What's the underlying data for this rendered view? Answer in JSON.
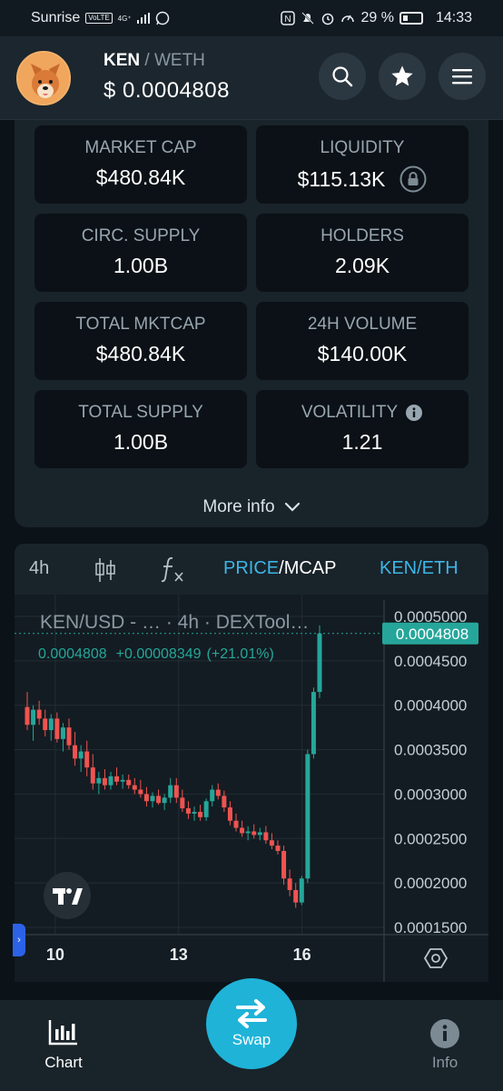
{
  "statusbar": {
    "carrier": "Sunrise",
    "volte": "VoLTE",
    "network": "4G⁺",
    "battery": "29 %",
    "time": "14:33"
  },
  "header": {
    "base_symbol": "KEN",
    "separator": "/",
    "quote_symbol": "WETH",
    "price": "$ 0.0004808"
  },
  "stats": [
    {
      "label": "MARKET CAP",
      "value": "$480.84K"
    },
    {
      "label": "LIQUIDITY",
      "value": "$115.13K",
      "locked": true
    },
    {
      "label": "CIRC. SUPPLY",
      "value": "1.00B"
    },
    {
      "label": "HOLDERS",
      "value": "2.09K"
    },
    {
      "label": "TOTAL MKTCAP",
      "value": "$480.84K"
    },
    {
      "label": "24H VOLUME",
      "value": "$140.00K"
    },
    {
      "label": "TOTAL SUPPLY",
      "value": "1.00B"
    },
    {
      "label": "VOLATILITY",
      "value": "1.21",
      "info": true
    }
  ],
  "more_info": "More info",
  "toolbar": {
    "interval": "4h",
    "price": "PRICE",
    "slash": "/",
    "mcap": "MCAP",
    "pair_toggle": "KEN/ETH"
  },
  "chart_data": {
    "type": "candlestick",
    "title": "KEN/USD - … · 4h · DEXTool…",
    "legend": {
      "last": "0.0004808",
      "change": "+0.00008349",
      "change_pct": "(+21.01%)"
    },
    "current_price_tag": "0.0004808",
    "y_ticks": [
      "0.0005000",
      "0.0004500",
      "0.0004000",
      "0.0003500",
      "0.0003000",
      "0.0002500",
      "0.0002000",
      "0.0001500"
    ],
    "x_ticks": [
      "10",
      "13",
      "16"
    ],
    "ylim": [
      0.00015,
      0.0005
    ],
    "grid": true,
    "colors": {
      "up": "#26a69a",
      "down": "#ef5350"
    },
    "candles": [
      [
        0.000398,
        0.000415,
        0.000372,
        0.000378
      ],
      [
        0.000378,
        0.0004,
        0.00036,
        0.000395
      ],
      [
        0.000395,
        0.000405,
        0.000378,
        0.000385
      ],
      [
        0.000385,
        0.000395,
        0.000365,
        0.000372
      ],
      [
        0.000372,
        0.00039,
        0.00036,
        0.000385
      ],
      [
        0.000385,
        0.000392,
        0.000358,
        0.000362
      ],
      [
        0.000362,
        0.00038,
        0.000348,
        0.000375
      ],
      [
        0.000375,
        0.000385,
        0.00035,
        0.000355
      ],
      [
        0.000355,
        0.00037,
        0.000332,
        0.00034
      ],
      [
        0.00034,
        0.000355,
        0.000325,
        0.000348
      ],
      [
        0.000348,
        0.00036,
        0.00032,
        0.00033
      ],
      [
        0.00033,
        0.000345,
        0.000305,
        0.000312
      ],
      [
        0.000312,
        0.000325,
        0.0003,
        0.000318
      ],
      [
        0.000318,
        0.000328,
        0.000305,
        0.00031
      ],
      [
        0.00031,
        0.000325,
        0.000305,
        0.00032
      ],
      [
        0.00032,
        0.00033,
        0.00031,
        0.000314
      ],
      [
        0.000314,
        0.000322,
        0.000306,
        0.000316
      ],
      [
        0.000316,
        0.000322,
        0.000306,
        0.00031
      ],
      [
        0.00031,
        0.000318,
        0.0003,
        0.000305
      ],
      [
        0.000305,
        0.000316,
        0.000296,
        0.0003
      ],
      [
        0.0003,
        0.000308,
        0.000286,
        0.000292
      ],
      [
        0.000292,
        0.000302,
        0.000285,
        0.000298
      ],
      [
        0.000298,
        0.000305,
        0.000288,
        0.00029
      ],
      [
        0.00029,
        0.0003,
        0.000282,
        0.000296
      ],
      [
        0.000296,
        0.000318,
        0.00029,
        0.00031
      ],
      [
        0.00031,
        0.000318,
        0.00029,
        0.000296
      ],
      [
        0.000296,
        0.000305,
        0.00028,
        0.000284
      ],
      [
        0.000284,
        0.000292,
        0.000272,
        0.000278
      ],
      [
        0.000278,
        0.000286,
        0.00027,
        0.00028
      ],
      [
        0.00028,
        0.000288,
        0.00027,
        0.000274
      ],
      [
        0.000274,
        0.000295,
        0.00027,
        0.000292
      ],
      [
        0.000292,
        0.00031,
        0.000286,
        0.000305
      ],
      [
        0.000305,
        0.000312,
        0.000294,
        0.000298
      ],
      [
        0.000298,
        0.000304,
        0.00028,
        0.000285
      ],
      [
        0.000285,
        0.000292,
        0.000265,
        0.00027
      ],
      [
        0.00027,
        0.000278,
        0.000258,
        0.000262
      ],
      [
        0.000262,
        0.00027,
        0.000252,
        0.000256
      ],
      [
        0.000256,
        0.000264,
        0.000248,
        0.000258
      ],
      [
        0.000258,
        0.000266,
        0.00025,
        0.000254
      ],
      [
        0.000254,
        0.000262,
        0.000248,
        0.000257
      ],
      [
        0.000257,
        0.000264,
        0.000244,
        0.000248
      ],
      [
        0.000248,
        0.000256,
        0.000238,
        0.000242
      ],
      [
        0.000242,
        0.000248,
        0.000232,
        0.000236
      ],
      [
        0.000236,
        0.000242,
        0.000198,
        0.000205
      ],
      [
        0.000205,
        0.000215,
        0.000185,
        0.000192
      ],
      [
        0.000192,
        0.0002,
        0.000172,
        0.000178
      ],
      [
        0.000178,
        0.000208,
        0.000175,
        0.000205
      ],
      [
        0.000205,
        0.00035,
        0.0002,
        0.000345
      ],
      [
        0.000345,
        0.00042,
        0.00034,
        0.000415
      ],
      [
        0.000415,
        0.00049,
        0.000408,
        0.0004808
      ]
    ]
  },
  "nav": {
    "chart": "Chart",
    "swap": "Swap",
    "info": "Info"
  }
}
